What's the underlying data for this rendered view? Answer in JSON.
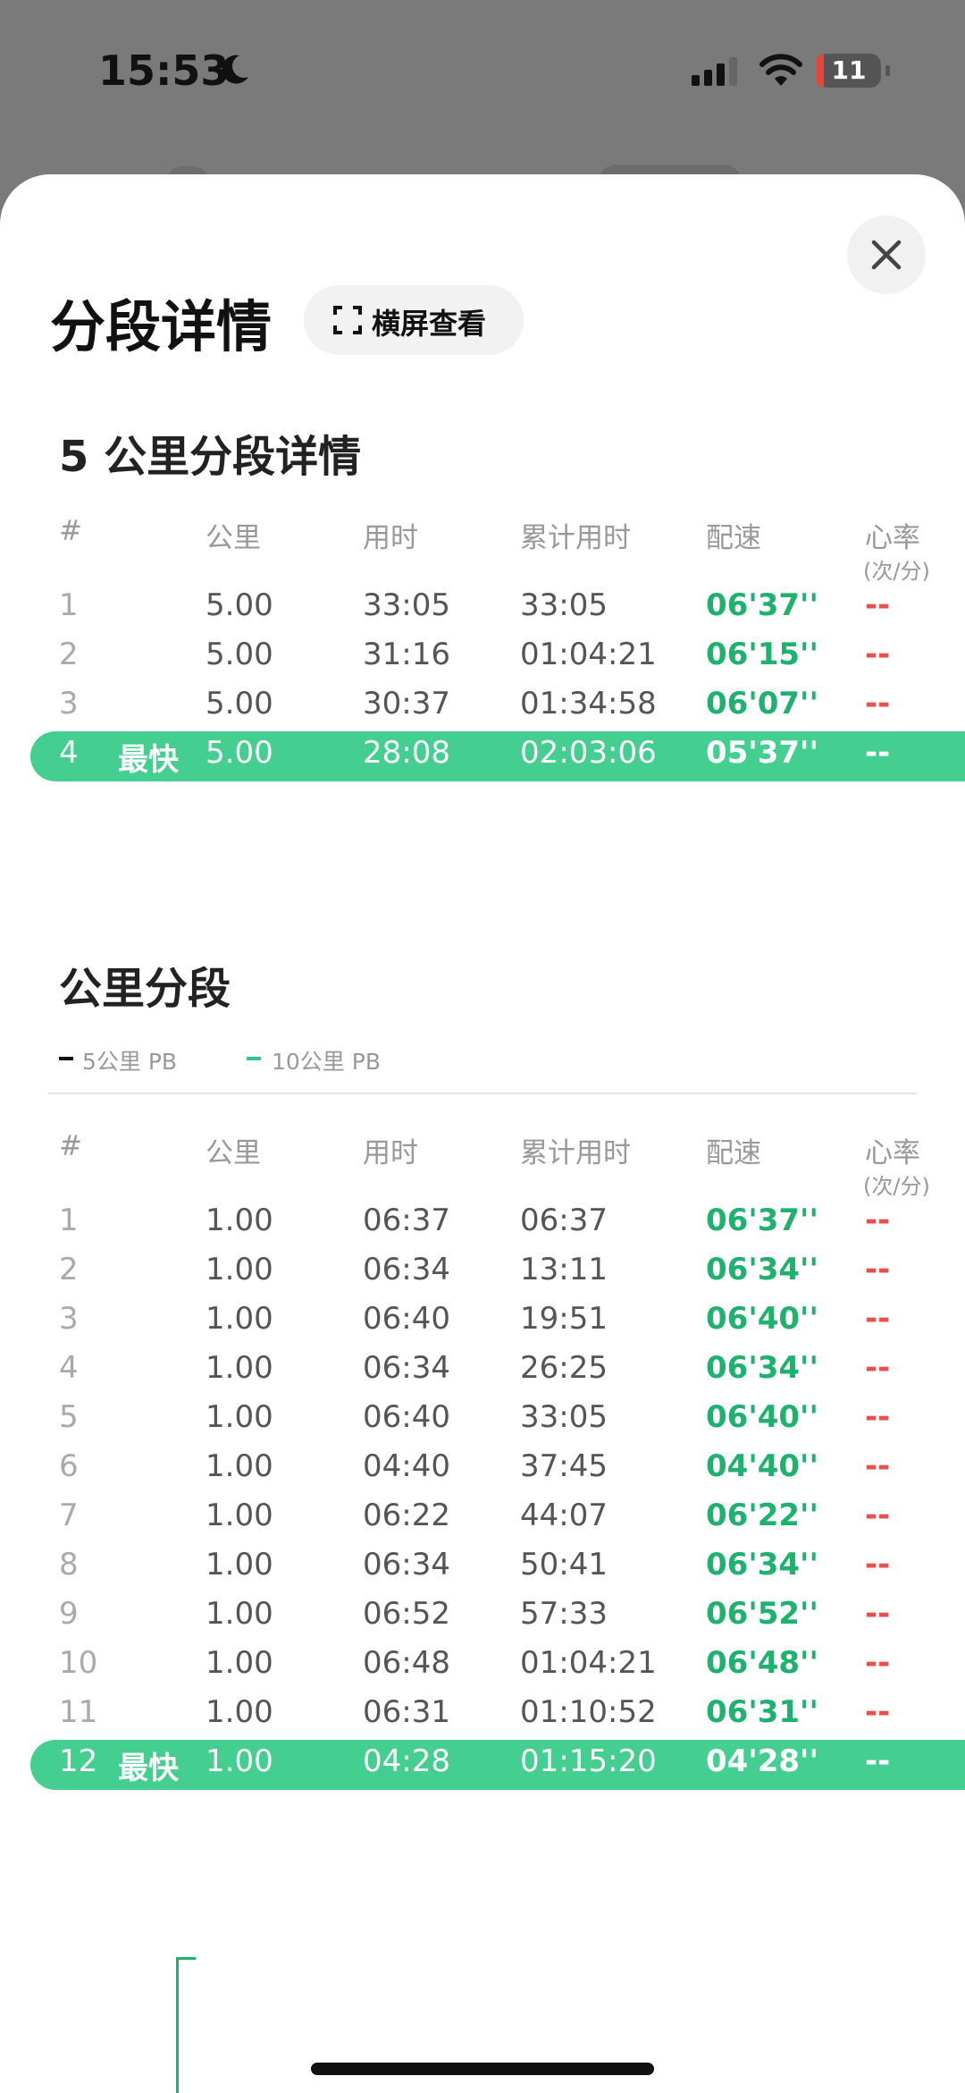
{
  "status_bar": {
    "time": "15:53",
    "battery": "11"
  },
  "header": {
    "title": "分段详情",
    "landscape_button": "横屏查看"
  },
  "section_5km": {
    "title": "5 公里分段详情",
    "columns": {
      "index": "#",
      "km": "公里",
      "time": "用时",
      "cumulative": "累计用时",
      "pace": "配速",
      "hr": "心率",
      "hr_unit": "(次/分)"
    },
    "rows": [
      {
        "index": "1",
        "tag": "",
        "km": "5.00",
        "time": "33:05",
        "cumulative": "33:05",
        "pace": "06'37''",
        "hr": "--",
        "best": false
      },
      {
        "index": "2",
        "tag": "",
        "km": "5.00",
        "time": "31:16",
        "cumulative": "01:04:21",
        "pace": "06'15''",
        "hr": "--",
        "best": false
      },
      {
        "index": "3",
        "tag": "",
        "km": "5.00",
        "time": "30:37",
        "cumulative": "01:34:58",
        "pace": "06'07''",
        "hr": "--",
        "best": false
      },
      {
        "index": "4",
        "tag": "最快",
        "km": "5.00",
        "time": "28:08",
        "cumulative": "02:03:06",
        "pace": "05'37''",
        "hr": "--",
        "best": true
      }
    ]
  },
  "section_1km": {
    "title": "公里分段",
    "legend": [
      {
        "label": "5公里 PB",
        "color": "#111111"
      },
      {
        "label": "10公里 PB",
        "color": "#2ec98a"
      }
    ],
    "columns": {
      "index": "#",
      "km": "公里",
      "time": "用时",
      "cumulative": "累计用时",
      "pace": "配速",
      "hr": "心率",
      "hr_unit": "(次/分)"
    },
    "rows": [
      {
        "index": "1",
        "tag": "",
        "km": "1.00",
        "time": "06:37",
        "cumulative": "06:37",
        "pace": "06'37''",
        "hr": "--",
        "best": false
      },
      {
        "index": "2",
        "tag": "",
        "km": "1.00",
        "time": "06:34",
        "cumulative": "13:11",
        "pace": "06'34''",
        "hr": "--",
        "best": false
      },
      {
        "index": "3",
        "tag": "",
        "km": "1.00",
        "time": "06:40",
        "cumulative": "19:51",
        "pace": "06'40''",
        "hr": "--",
        "best": false
      },
      {
        "index": "4",
        "tag": "",
        "km": "1.00",
        "time": "06:34",
        "cumulative": "26:25",
        "pace": "06'34''",
        "hr": "--",
        "best": false
      },
      {
        "index": "5",
        "tag": "",
        "km": "1.00",
        "time": "06:40",
        "cumulative": "33:05",
        "pace": "06'40''",
        "hr": "--",
        "best": false
      },
      {
        "index": "6",
        "tag": "",
        "km": "1.00",
        "time": "04:40",
        "cumulative": "37:45",
        "pace": "04'40''",
        "hr": "--",
        "best": false
      },
      {
        "index": "7",
        "tag": "",
        "km": "1.00",
        "time": "06:22",
        "cumulative": "44:07",
        "pace": "06'22''",
        "hr": "--",
        "best": false
      },
      {
        "index": "8",
        "tag": "",
        "km": "1.00",
        "time": "06:34",
        "cumulative": "50:41",
        "pace": "06'34''",
        "hr": "--",
        "best": false
      },
      {
        "index": "9",
        "tag": "",
        "km": "1.00",
        "time": "06:52",
        "cumulative": "57:33",
        "pace": "06'52''",
        "hr": "--",
        "best": false
      },
      {
        "index": "10",
        "tag": "",
        "km": "1.00",
        "time": "06:48",
        "cumulative": "01:04:21",
        "pace": "06'48''",
        "hr": "--",
        "best": false
      },
      {
        "index": "11",
        "tag": "",
        "km": "1.00",
        "time": "06:31",
        "cumulative": "01:10:52",
        "pace": "06'31''",
        "hr": "--",
        "best": false
      },
      {
        "index": "12",
        "tag": "最快",
        "km": "1.00",
        "time": "04:28",
        "cumulative": "01:15:20",
        "pace": "04'28''",
        "hr": "--",
        "best": true
      }
    ]
  },
  "colors": {
    "accent": "#44cf91",
    "pace": "#1fb26f",
    "heart_rate": "#e85050"
  }
}
